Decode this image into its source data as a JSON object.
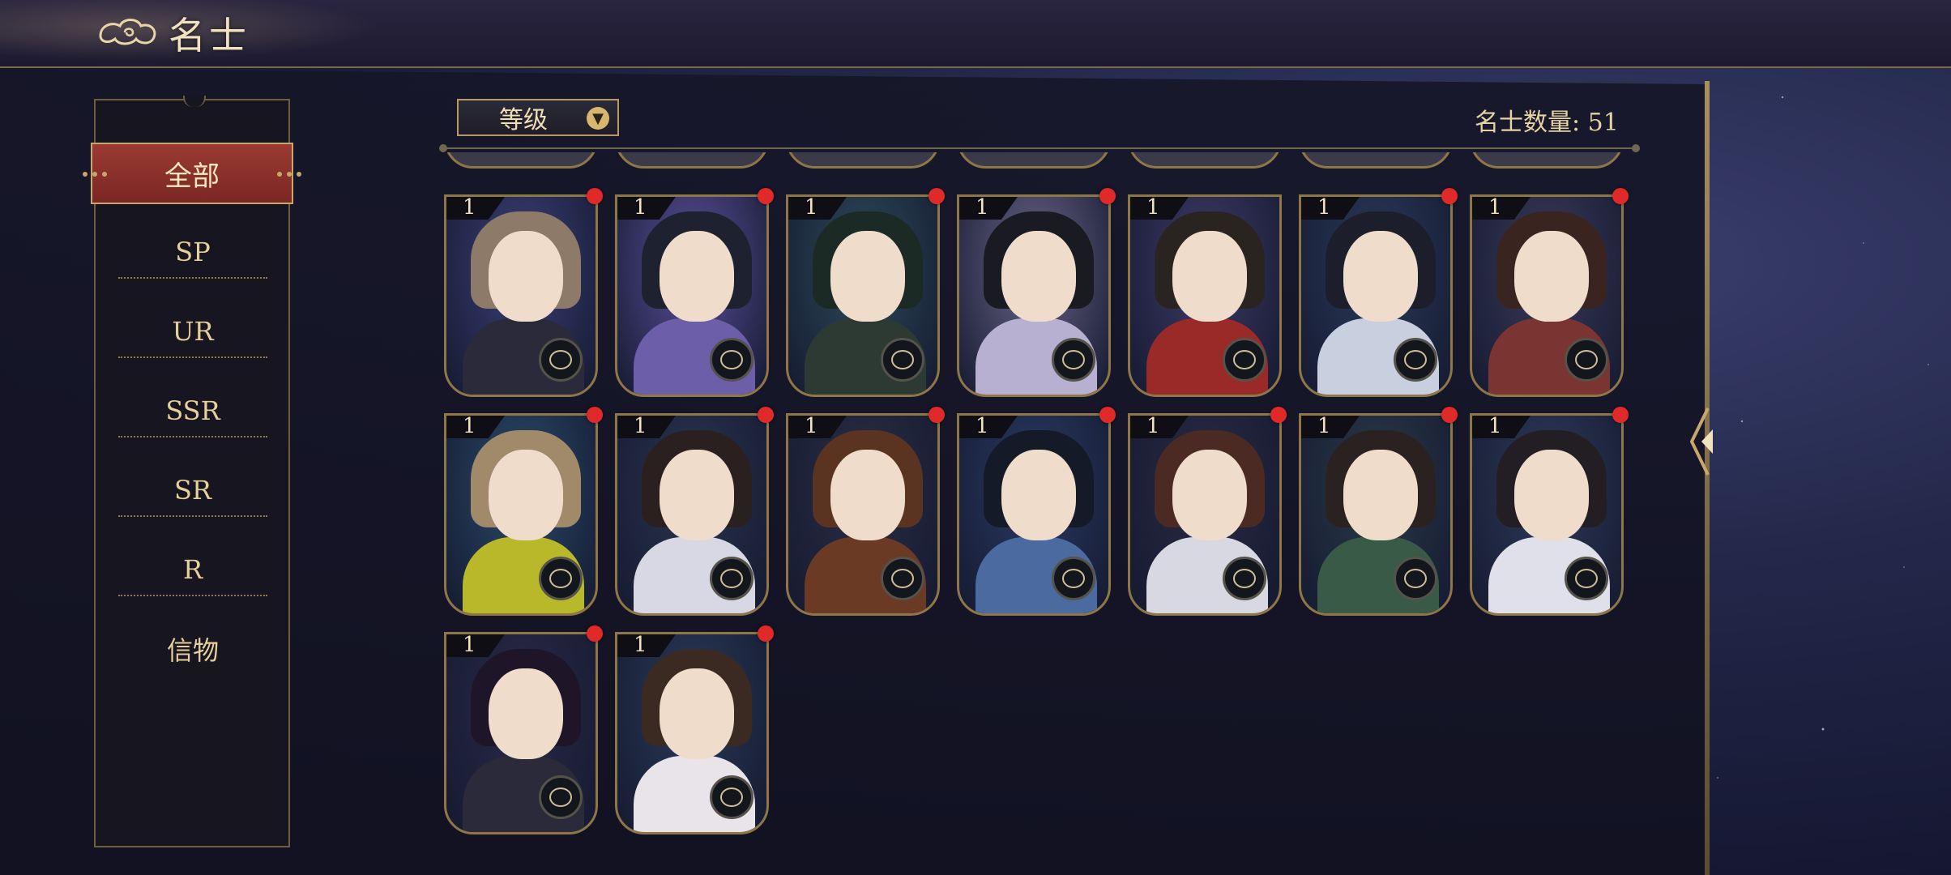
{
  "header": {
    "title": "名士",
    "icon": "cloud-icon"
  },
  "sidebar": {
    "active": "全部",
    "items": [
      {
        "label": "全部",
        "active": true
      },
      {
        "label": "SP"
      },
      {
        "label": "UR"
      },
      {
        "label": "SSR"
      },
      {
        "label": "SR"
      },
      {
        "label": "R"
      },
      {
        "label": "信物"
      }
    ]
  },
  "toolbar": {
    "sort_label": "等级",
    "sort_icon": "chevron-down-icon",
    "count_label": "名士数量: 51"
  },
  "cards": [
    {
      "level": "1",
      "new": true,
      "hair": "#8d7a68",
      "bg": "#3b3f78",
      "body": "#2a2a3a"
    },
    {
      "level": "1",
      "new": true,
      "hair": "#1e2230",
      "bg": "#5a4f9a",
      "body": "#6c5ea8"
    },
    {
      "level": "1",
      "new": true,
      "hair": "#1c2a26",
      "bg": "#2d4a5a",
      "body": "#2d3a34"
    },
    {
      "level": "1",
      "new": true,
      "hair": "#1a1a22",
      "bg": "#6a6488",
      "body": "#b7b0d0"
    },
    {
      "level": "1",
      "new": false,
      "hair": "#2a2420",
      "bg": "#3e3a68",
      "body": "#9a2a28"
    },
    {
      "level": "1",
      "new": true,
      "hair": "#1c1e2c",
      "bg": "#2a3a5a",
      "body": "#c8d0e0"
    },
    {
      "level": "1",
      "new": true,
      "hair": "#3a2420",
      "bg": "#3a3a5a",
      "body": "#7a3432"
    },
    {
      "level": "1",
      "new": true,
      "hair": "#a08a6a",
      "bg": "#2a4a6a",
      "body": "#b8b82a"
    },
    {
      "level": "1",
      "new": true,
      "hair": "#2a2020",
      "bg": "#2a3450",
      "body": "#d8d8e4"
    },
    {
      "level": "1",
      "new": true,
      "hair": "#5a3420",
      "bg": "#2a2e44",
      "body": "#6a3a24"
    },
    {
      "level": "1",
      "new": true,
      "hair": "#141a28",
      "bg": "#2a3a64",
      "body": "#4a6aa0"
    },
    {
      "level": "1",
      "new": true,
      "hair": "#4a2a22",
      "bg": "#2a2a44",
      "body": "#d8d8e2"
    },
    {
      "level": "1",
      "new": true,
      "hair": "#2a2220",
      "bg": "#2a3a4a",
      "body": "#3a5a48"
    },
    {
      "level": "1",
      "new": true,
      "hair": "#221e24",
      "bg": "#2e3a5a",
      "body": "#e0e0ea"
    },
    {
      "level": "1",
      "new": true,
      "hair": "#1e1628",
      "bg": "#2a2a48",
      "body": "#2a2a3a"
    },
    {
      "level": "1",
      "new": true,
      "hair": "#3a2a22",
      "bg": "#2a3a58",
      "body": "#e8e4ea"
    }
  ],
  "colors": {
    "accent_red": "#9b3a33",
    "gold": "#c9a76a",
    "dot_red": "#e02a2a"
  }
}
